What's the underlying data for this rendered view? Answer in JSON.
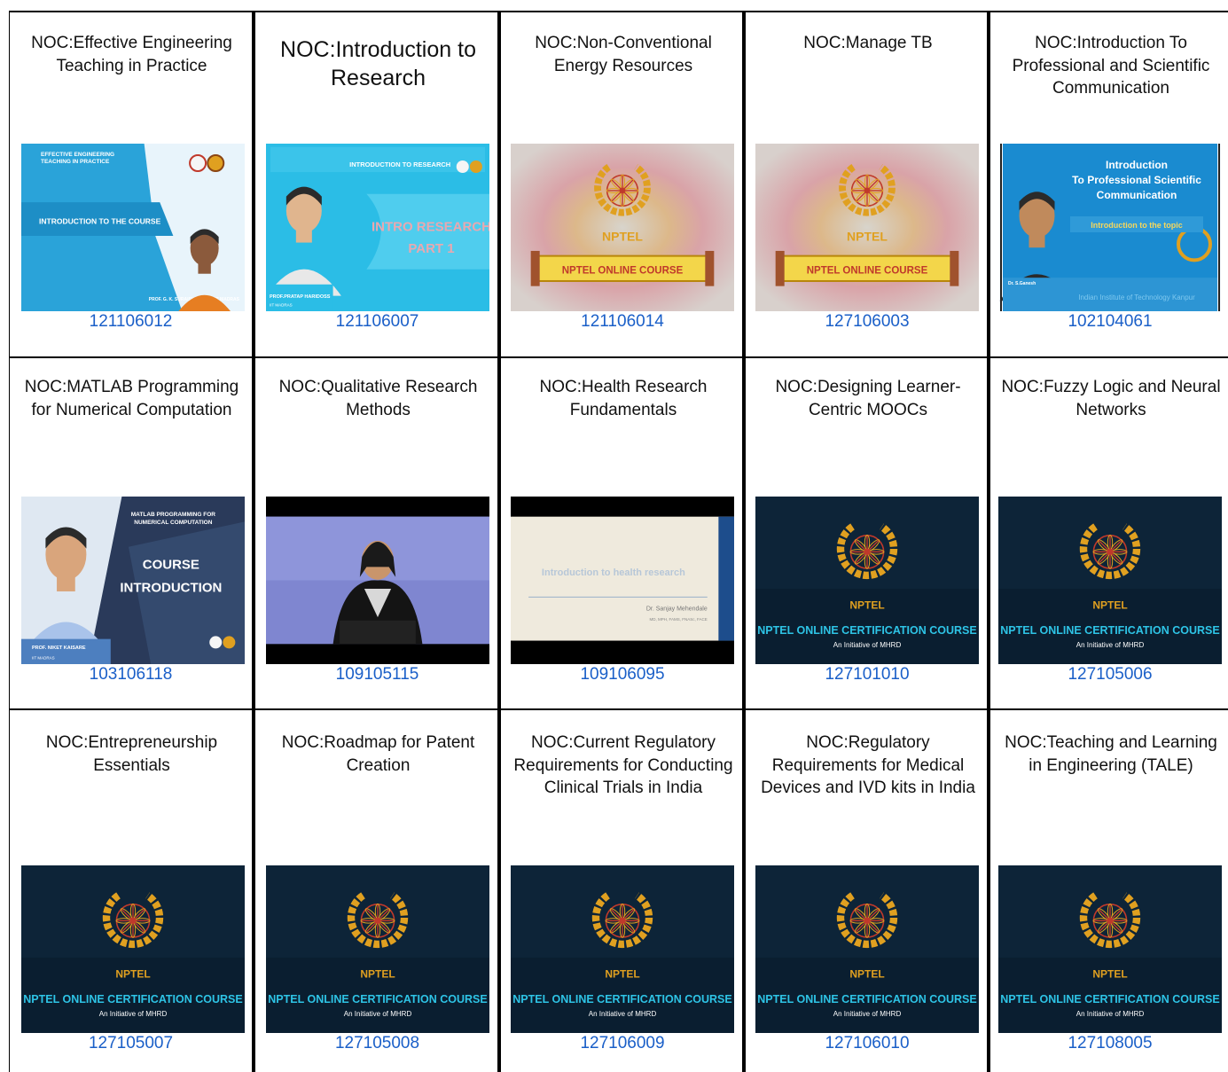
{
  "courses": [
    {
      "title": "NOC:Effective Engineering Teaching in Practice",
      "code": "121106012",
      "thumb": {
        "kind": "slide-blue",
        "heading": "EFFECTIVE ENGINEERING TEACHING IN PRACTICE",
        "main": "INTRODUCTION TO THE COURSE",
        "footer": "PROF. G. K. SURAISHKUMAR, IIT MADRAS"
      }
    },
    {
      "title": "NOC:Introduction to Research",
      "code": "121106007",
      "thumb": {
        "kind": "slide-cyan",
        "heading": "INTRODUCTION TO RESEARCH",
        "main": "INTRO RESEARCH PART 1",
        "footer": "PROF.PRATAP HARIDOSS IIT MADRAS"
      }
    },
    {
      "title": "NOC:Non-Conventional Energy Resources",
      "code": "121106014",
      "thumb": {
        "kind": "nptel-light",
        "brand": "NPTEL",
        "banner": "NPTEL ONLINE COURSE"
      }
    },
    {
      "title": "NOC:Manage TB",
      "code": "127106003",
      "thumb": {
        "kind": "nptel-light",
        "brand": "NPTEL",
        "banner": "NPTEL ONLINE COURSE"
      }
    },
    {
      "title": "NOC:Introduction To Professional and Scientific Communication",
      "code": "102104061",
      "thumb": {
        "kind": "slide-comm",
        "heading": "Introduction To Professional Scientific Communication",
        "main": "Introduction to the topic",
        "footer": "Indian Institute of Technology Kanpur",
        "presenter": "Dr. S.Ganesh"
      }
    },
    {
      "title": "NOC:MATLAB Programming for Numerical Computation",
      "code": "103106118",
      "thumb": {
        "kind": "slide-matlab",
        "heading": "MATLAB PROGRAMMING FOR NUMERICAL COMPUTATION",
        "main": "COURSE INTRODUCTION",
        "footer": "PROF. NIKET KAISARE IIT MADRAS"
      }
    },
    {
      "title": "NOC:Qualitative Research Methods",
      "code": "109105115",
      "thumb": {
        "kind": "lecture-video"
      }
    },
    {
      "title": "NOC:Health Research Fundamentals",
      "code": "109106095",
      "thumb": {
        "kind": "slide-health",
        "main": "Introduction to health research",
        "footer": "Dr. Sanjay Mehendale"
      }
    },
    {
      "title": "NOC:Designing Learner-Centric MOOCs",
      "code": "127101010",
      "thumb": {
        "kind": "nptel-dark",
        "brand": "NPTEL",
        "banner": "NPTEL ONLINE CERTIFICATION COURSE",
        "sub": "An Initiative of MHRD"
      }
    },
    {
      "title": "NOC:Fuzzy Logic and Neural Networks",
      "code": "127105006",
      "thumb": {
        "kind": "nptel-dark",
        "brand": "NPTEL",
        "banner": "NPTEL ONLINE CERTIFICATION COURSE",
        "sub": "An Initiative of MHRD"
      }
    },
    {
      "title": "NOC:Entrepreneurship Essentials",
      "code": "127105007",
      "thumb": {
        "kind": "nptel-dark",
        "brand": "NPTEL",
        "banner": "NPTEL ONLINE CERTIFICATION COURSE",
        "sub": "An Initiative of MHRD"
      }
    },
    {
      "title": "NOC:Roadmap for Patent Creation",
      "code": "127105008",
      "thumb": {
        "kind": "nptel-dark",
        "brand": "NPTEL",
        "banner": "NPTEL ONLINE CERTIFICATION COURSE",
        "sub": "An Initiative of MHRD"
      }
    },
    {
      "title": "NOC:Current Regulatory Requirements for Conducting Clinical Trials in India",
      "code": "127106009",
      "thumb": {
        "kind": "nptel-dark",
        "brand": "NPTEL",
        "banner": "NPTEL ONLINE CERTIFICATION COURSE",
        "sub": "An Initiative of MHRD"
      }
    },
    {
      "title": "NOC:Regulatory Requirements for Medical Devices and IVD kits in India",
      "code": "127106010",
      "thumb": {
        "kind": "nptel-dark",
        "brand": "NPTEL",
        "banner": "NPTEL ONLINE CERTIFICATION COURSE",
        "sub": "An Initiative of MHRD"
      }
    },
    {
      "title": "NOC:Teaching and Learning in Engineering (TALE)",
      "code": "127108005",
      "thumb": {
        "kind": "nptel-dark",
        "brand": "NPTEL",
        "banner": "NPTEL ONLINE CERTIFICATION COURSE",
        "sub": "An Initiative of MHRD"
      }
    }
  ],
  "colors": {
    "link": "#1a5fc8",
    "border": "#000000",
    "nptel_dark_bg": "#0d2438",
    "banner_cyan": "#2ec4e6"
  }
}
